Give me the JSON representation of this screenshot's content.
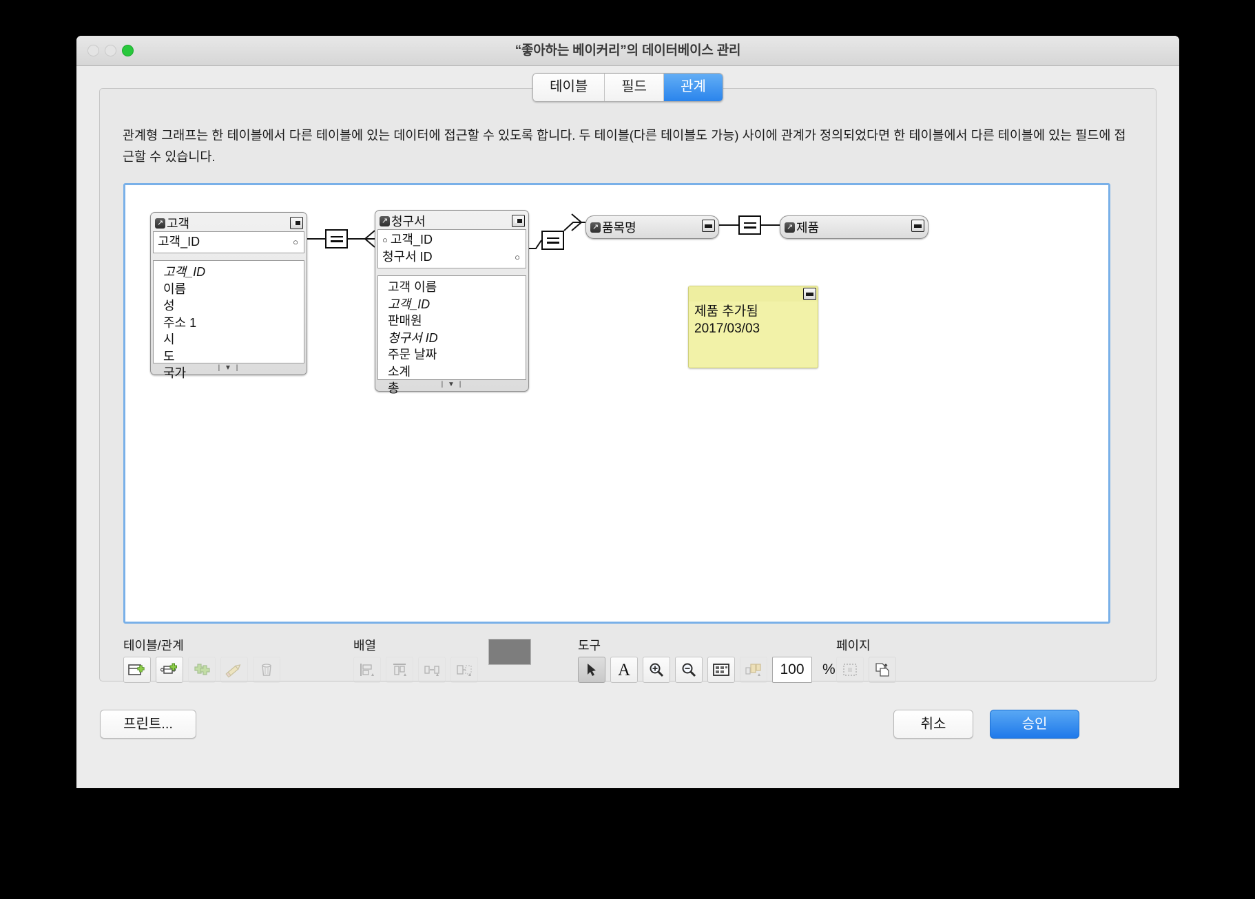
{
  "window": {
    "title": "“좋아하는 베이커리”의 데이터베이스 관리",
    "lights": [
      "close",
      "minimize",
      "zoom"
    ]
  },
  "tabs": [
    {
      "label": "테이블",
      "active": false
    },
    {
      "label": "필드",
      "active": false
    },
    {
      "label": "관계",
      "active": true
    }
  ],
  "description": "관계형 그래프는 한 테이블에서 다른 테이블에 있는 데이터에 접근할 수 있도록 합니다. 두 테이블(다른 테이블도 가능) 사이에 관계가 정의되었다면 한 테이블에서 다른 테이블에 있는 필드에 접근할 수 있습니다.",
  "graph": {
    "tables": [
      {
        "name": "고객",
        "collapsed": false,
        "keys": [
          {
            "text": "고객_ID",
            "dot_left": false,
            "dot_right": true
          }
        ],
        "fields": [
          {
            "text": "고객_ID",
            "italic": true
          },
          {
            "text": "이름",
            "italic": false
          },
          {
            "text": "성",
            "italic": false
          },
          {
            "text": "주소 1",
            "italic": false
          },
          {
            "text": "시",
            "italic": false
          },
          {
            "text": "도",
            "italic": false
          },
          {
            "text": "국가",
            "italic": false
          }
        ]
      },
      {
        "name": "청구서",
        "collapsed": false,
        "keys": [
          {
            "text": "고객_ID",
            "dot_left": true,
            "dot_right": false
          },
          {
            "text": "청구서 ID",
            "dot_left": false,
            "dot_right": true
          }
        ],
        "fields": [
          {
            "text": "고객 이름",
            "italic": false
          },
          {
            "text": "고객_ID",
            "italic": true
          },
          {
            "text": "판매원",
            "italic": false
          },
          {
            "text": "청구서 ID",
            "italic": true
          },
          {
            "text": "주문 날짜",
            "italic": false
          },
          {
            "text": "소계",
            "italic": false
          },
          {
            "text": "총",
            "italic": false
          }
        ]
      },
      {
        "name": "품목명",
        "collapsed": true,
        "keys": [],
        "fields": []
      },
      {
        "name": "제품",
        "collapsed": true,
        "keys": [],
        "fields": []
      }
    ],
    "relations": [
      {
        "operator": "=",
        "from": "고객",
        "to": "청구서"
      },
      {
        "operator": "=",
        "from": "청구서",
        "to": "품목명"
      },
      {
        "operator": "=",
        "from": "품목명",
        "to": "제품"
      }
    ],
    "note": {
      "line1": "제품 추가됨",
      "line2": "2017/03/03",
      "color": "#f2f2a8"
    }
  },
  "toolbar": {
    "groups": [
      {
        "label": "테이블/관계",
        "buttons": [
          {
            "icon": "new-table-icon",
            "state": "normal"
          },
          {
            "icon": "new-relationship-icon",
            "state": "normal"
          },
          {
            "icon": "duplicate-icon",
            "state": "disabled"
          },
          {
            "icon": "edit-pencil-icon",
            "state": "disabled"
          },
          {
            "icon": "delete-trash-icon",
            "state": "disabled"
          }
        ]
      },
      {
        "label": "배열",
        "buttons": [
          {
            "icon": "align-left-icon",
            "state": "disabled"
          },
          {
            "icon": "align-top-icon",
            "state": "disabled"
          },
          {
            "icon": "distribute-horizontal-icon",
            "state": "disabled"
          },
          {
            "icon": "resize-to-fit-icon",
            "state": "disabled"
          }
        ]
      },
      {
        "label": "",
        "buttons": [
          {
            "icon": "color-swatch",
            "state": "normal"
          }
        ]
      },
      {
        "label": "도구",
        "buttons": [
          {
            "icon": "pointer-arrow-icon",
            "state": "selected"
          },
          {
            "icon": "text-tool-icon",
            "state": "normal"
          },
          {
            "icon": "zoom-in-icon",
            "state": "normal"
          },
          {
            "icon": "zoom-out-icon",
            "state": "normal"
          },
          {
            "icon": "fit-window-icon",
            "state": "normal"
          },
          {
            "icon": "selected-objects-icon",
            "state": "disabled"
          }
        ]
      },
      {
        "label": "페이지",
        "buttons": [
          {
            "icon": "page-breaks-icon",
            "state": "disabled"
          },
          {
            "icon": "page-setup-icon",
            "state": "normal"
          }
        ]
      }
    ],
    "zoom": {
      "value": "100",
      "unit": "%"
    }
  },
  "footer": {
    "print_label": "프린트...",
    "cancel_label": "취소",
    "ok_label": "승인"
  }
}
